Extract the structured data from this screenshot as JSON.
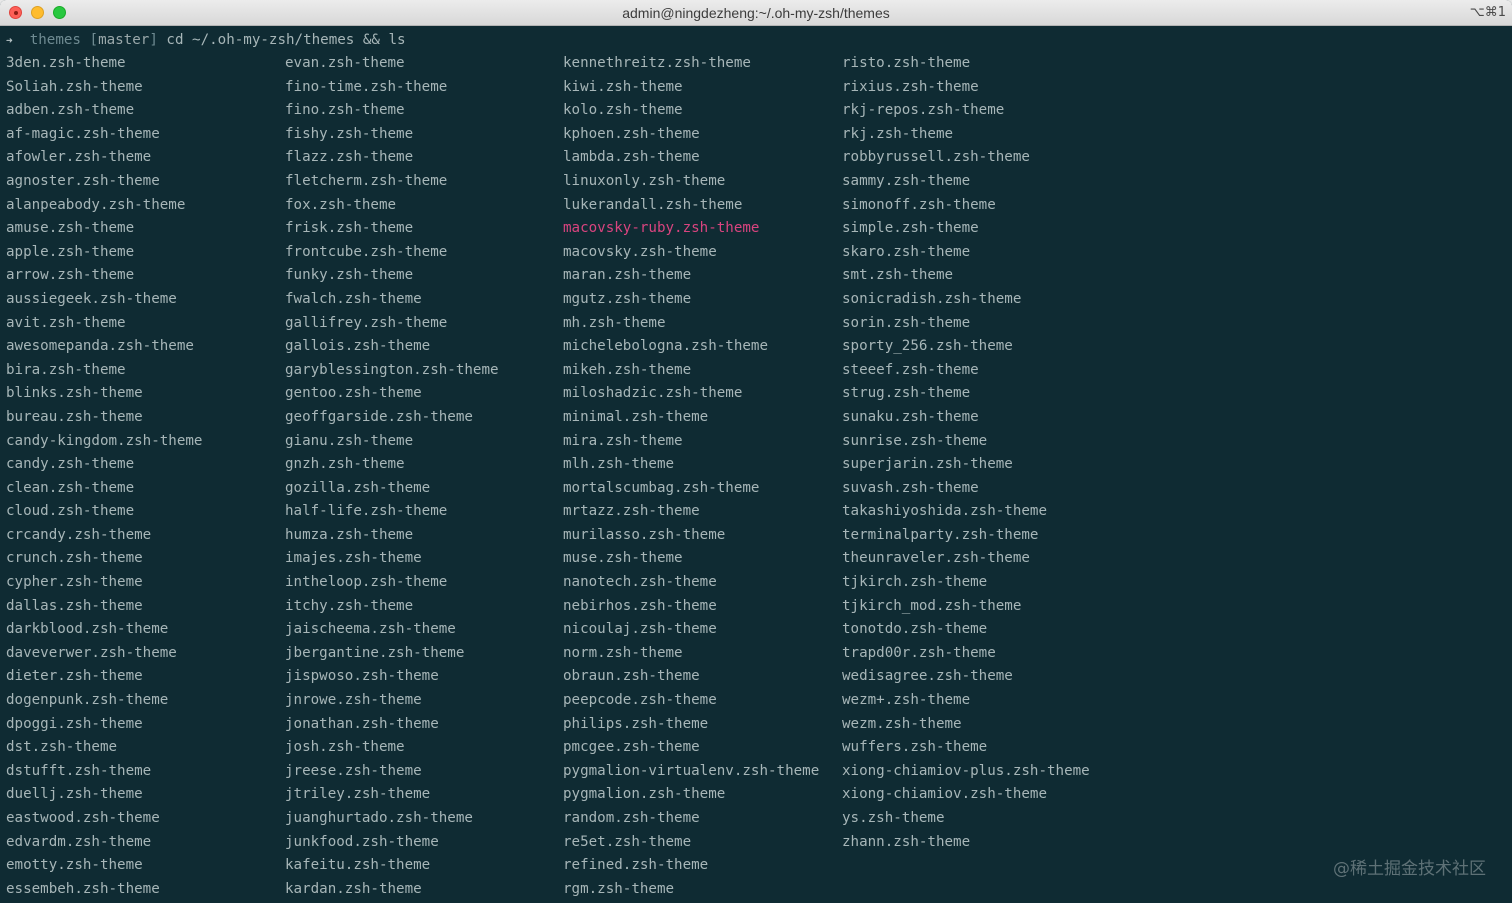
{
  "window": {
    "title": "admin@ningdezheng:~/.oh-my-zsh/themes",
    "shortcut": "⌥⌘1"
  },
  "prompt": {
    "arrow": "➜",
    "dir": "themes",
    "branch_open": "[",
    "branch": "master",
    "branch_close": "]",
    "command": "cd ~/.oh-my-zsh/themes && ls"
  },
  "highlight_color": "#d9447f",
  "columns": [
    [
      "3den.zsh-theme",
      "Soliah.zsh-theme",
      "adben.zsh-theme",
      "af-magic.zsh-theme",
      "afowler.zsh-theme",
      "agnoster.zsh-theme",
      "alanpeabody.zsh-theme",
      "amuse.zsh-theme",
      "apple.zsh-theme",
      "arrow.zsh-theme",
      "aussiegeek.zsh-theme",
      "avit.zsh-theme",
      "awesomepanda.zsh-theme",
      "bira.zsh-theme",
      "blinks.zsh-theme",
      "bureau.zsh-theme",
      "candy-kingdom.zsh-theme",
      "candy.zsh-theme",
      "clean.zsh-theme",
      "cloud.zsh-theme",
      "crcandy.zsh-theme",
      "crunch.zsh-theme",
      "cypher.zsh-theme",
      "dallas.zsh-theme",
      "darkblood.zsh-theme",
      "daveverwer.zsh-theme",
      "dieter.zsh-theme",
      "dogenpunk.zsh-theme",
      "dpoggi.zsh-theme",
      "dst.zsh-theme",
      "dstufft.zsh-theme",
      "duellj.zsh-theme",
      "eastwood.zsh-theme",
      "edvardm.zsh-theme",
      "emotty.zsh-theme",
      "essembeh.zsh-theme"
    ],
    [
      "evan.zsh-theme",
      "fino-time.zsh-theme",
      "fino.zsh-theme",
      "fishy.zsh-theme",
      "flazz.zsh-theme",
      "fletcherm.zsh-theme",
      "fox.zsh-theme",
      "frisk.zsh-theme",
      "frontcube.zsh-theme",
      "funky.zsh-theme",
      "fwalch.zsh-theme",
      "gallifrey.zsh-theme",
      "gallois.zsh-theme",
      "garyblessington.zsh-theme",
      "gentoo.zsh-theme",
      "geoffgarside.zsh-theme",
      "gianu.zsh-theme",
      "gnzh.zsh-theme",
      "gozilla.zsh-theme",
      "half-life.zsh-theme",
      "humza.zsh-theme",
      "imajes.zsh-theme",
      "intheloop.zsh-theme",
      "itchy.zsh-theme",
      "jaischeema.zsh-theme",
      "jbergantine.zsh-theme",
      "jispwoso.zsh-theme",
      "jnrowe.zsh-theme",
      "jonathan.zsh-theme",
      "josh.zsh-theme",
      "jreese.zsh-theme",
      "jtriley.zsh-theme",
      "juanghurtado.zsh-theme",
      "junkfood.zsh-theme",
      "kafeitu.zsh-theme",
      "kardan.zsh-theme"
    ],
    [
      "kennethreitz.zsh-theme",
      "kiwi.zsh-theme",
      "kolo.zsh-theme",
      "kphoen.zsh-theme",
      "lambda.zsh-theme",
      "linuxonly.zsh-theme",
      "lukerandall.zsh-theme",
      "macovsky-ruby.zsh-theme",
      "macovsky.zsh-theme",
      "maran.zsh-theme",
      "mgutz.zsh-theme",
      "mh.zsh-theme",
      "michelebologna.zsh-theme",
      "mikeh.zsh-theme",
      "miloshadzic.zsh-theme",
      "minimal.zsh-theme",
      "mira.zsh-theme",
      "mlh.zsh-theme",
      "mortalscumbag.zsh-theme",
      "mrtazz.zsh-theme",
      "murilasso.zsh-theme",
      "muse.zsh-theme",
      "nanotech.zsh-theme",
      "nebirhos.zsh-theme",
      "nicoulaj.zsh-theme",
      "norm.zsh-theme",
      "obraun.zsh-theme",
      "peepcode.zsh-theme",
      "philips.zsh-theme",
      "pmcgee.zsh-theme",
      "pygmalion-virtualenv.zsh-theme",
      "pygmalion.zsh-theme",
      "random.zsh-theme",
      "re5et.zsh-theme",
      "refined.zsh-theme",
      "rgm.zsh-theme"
    ],
    [
      "risto.zsh-theme",
      "rixius.zsh-theme",
      "rkj-repos.zsh-theme",
      "rkj.zsh-theme",
      "robbyrussell.zsh-theme",
      "sammy.zsh-theme",
      "simonoff.zsh-theme",
      "simple.zsh-theme",
      "skaro.zsh-theme",
      "smt.zsh-theme",
      "sonicradish.zsh-theme",
      "sorin.zsh-theme",
      "sporty_256.zsh-theme",
      "steeef.zsh-theme",
      "strug.zsh-theme",
      "sunaku.zsh-theme",
      "sunrise.zsh-theme",
      "superjarin.zsh-theme",
      "suvash.zsh-theme",
      "takashiyoshida.zsh-theme",
      "terminalparty.zsh-theme",
      "theunraveler.zsh-theme",
      "tjkirch.zsh-theme",
      "tjkirch_mod.zsh-theme",
      "tonotdo.zsh-theme",
      "trapd00r.zsh-theme",
      "wedisagree.zsh-theme",
      "wezm+.zsh-theme",
      "wezm.zsh-theme",
      "wuffers.zsh-theme",
      "xiong-chiamiov-plus.zsh-theme",
      "xiong-chiamiov.zsh-theme",
      "ys.zsh-theme",
      "zhann.zsh-theme"
    ]
  ],
  "highlighted_item": "macovsky-ruby.zsh-theme",
  "watermark": "@稀土掘金技术社区"
}
